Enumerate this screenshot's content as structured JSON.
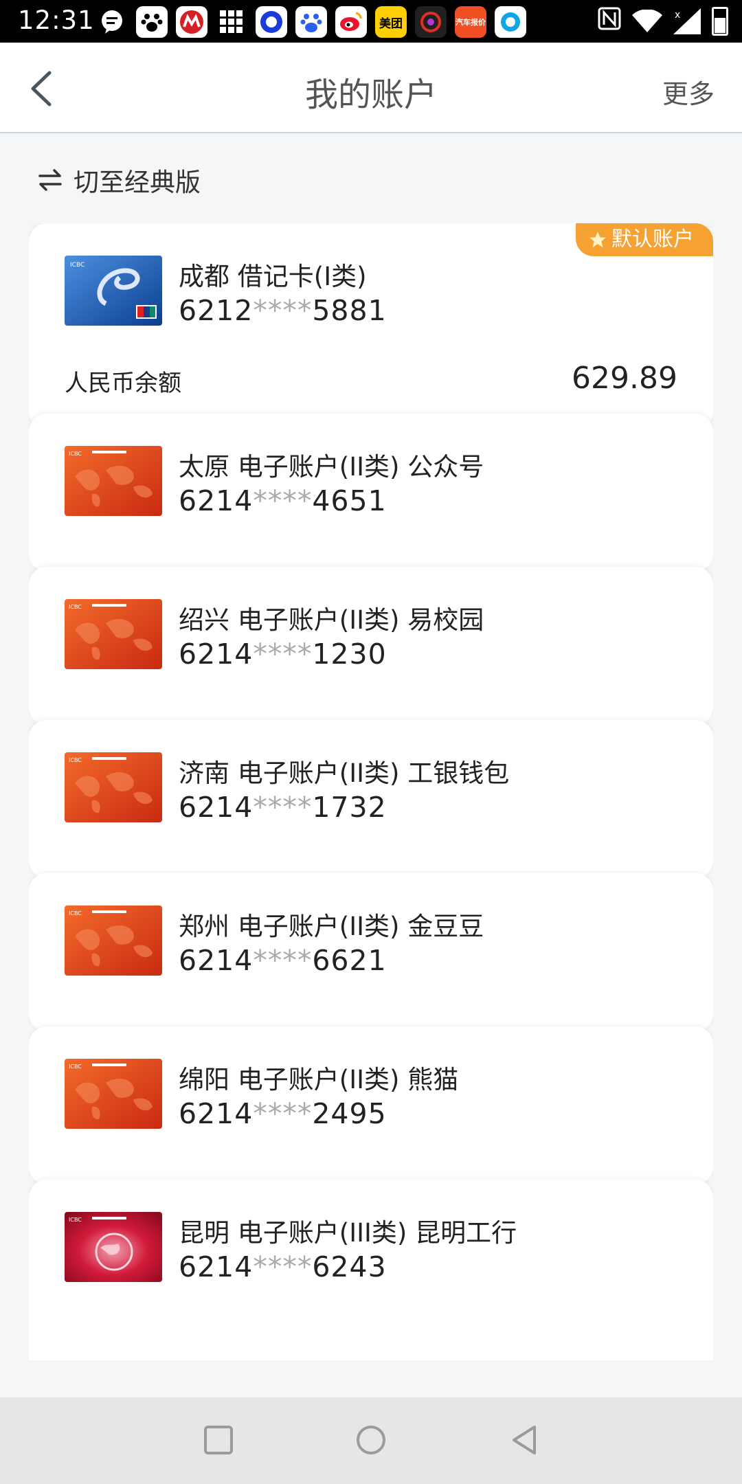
{
  "status_bar": {
    "time": "12:31",
    "app_icons": [
      {
        "name": "message-icon",
        "color": "#000000"
      },
      {
        "name": "baidu-paw-icon",
        "color": "#000000"
      },
      {
        "name": "cmb-icon",
        "color": "#d71f26"
      },
      {
        "name": "grid-apps-icon",
        "color": "#000000"
      },
      {
        "name": "circle-app-icon",
        "color": "#1a3bd8"
      },
      {
        "name": "baidu-icon",
        "color": "#2b5ff0"
      },
      {
        "name": "weibo-icon",
        "color": "#f3c400"
      },
      {
        "name": "meituan-icon",
        "color": "#ffd000"
      },
      {
        "name": "pinduoduo-icon",
        "color": "#202020"
      },
      {
        "name": "car-report-icon",
        "color": "#f04e23"
      },
      {
        "name": "browser-icon",
        "color": "#0fa5e9"
      }
    ],
    "meituan_text": "美团",
    "car_text": "汽车报价"
  },
  "header": {
    "title": "我的账户",
    "more_label": "更多"
  },
  "switch_label": "切至经典版",
  "accounts": [
    {
      "name": "成都 借记卡(I类)",
      "num_prefix": "6212",
      "num_mask": "****",
      "num_suffix": "5881",
      "badge": "默认账户",
      "balance_label": "人民币余额",
      "balance": "629.89",
      "card_style": "blue"
    },
    {
      "name": "太原 电子账户(II类) 公众号",
      "num_prefix": "6214",
      "num_mask": "****",
      "num_suffix": "4651",
      "card_style": "orange"
    },
    {
      "name": "绍兴 电子账户(II类) 易校园",
      "num_prefix": "6214",
      "num_mask": "****",
      "num_suffix": "1230",
      "card_style": "orange"
    },
    {
      "name": "济南 电子账户(II类) 工银钱包",
      "num_prefix": "6214",
      "num_mask": "****",
      "num_suffix": "1732",
      "card_style": "orange"
    },
    {
      "name": "郑州 电子账户(II类) 金豆豆",
      "num_prefix": "6214",
      "num_mask": "****",
      "num_suffix": "6621",
      "card_style": "orange"
    },
    {
      "name": "绵阳 电子账户(II类) 熊猫",
      "num_prefix": "6214",
      "num_mask": "****",
      "num_suffix": "2495",
      "card_style": "orange"
    },
    {
      "name": "昆明 电子账户(III类) 昆明工行",
      "num_prefix": "6214",
      "num_mask": "****",
      "num_suffix": "6243",
      "card_style": "red"
    }
  ],
  "colors": {
    "badge": "#f6a233",
    "orange_card": "#e8491d",
    "blue_card": "#1a5fb4",
    "red_card": "#c8102e"
  }
}
